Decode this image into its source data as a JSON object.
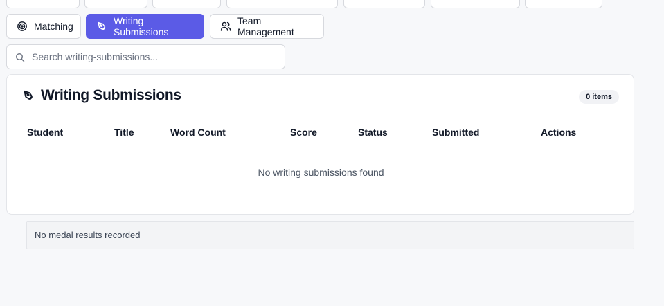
{
  "tabs": [
    {
      "label": "Matching",
      "icon": "target-icon",
      "active": false
    },
    {
      "label": "Writing Submissions",
      "icon": "pen-tool-icon",
      "active": true
    },
    {
      "label": "Team Management",
      "icon": "users-icon",
      "active": false
    }
  ],
  "search": {
    "placeholder": "Search writing-submissions..."
  },
  "card": {
    "title": "Writing Submissions",
    "badge": "0 items",
    "columns": [
      "Student",
      "Title",
      "Word Count",
      "Score",
      "Status",
      "Submitted",
      "Actions"
    ],
    "empty_message": "No writing submissions found"
  },
  "notice": {
    "text": "No medal results recorded"
  },
  "colors": {
    "accent": "#5b5be6",
    "background": "#f7f8fa"
  }
}
